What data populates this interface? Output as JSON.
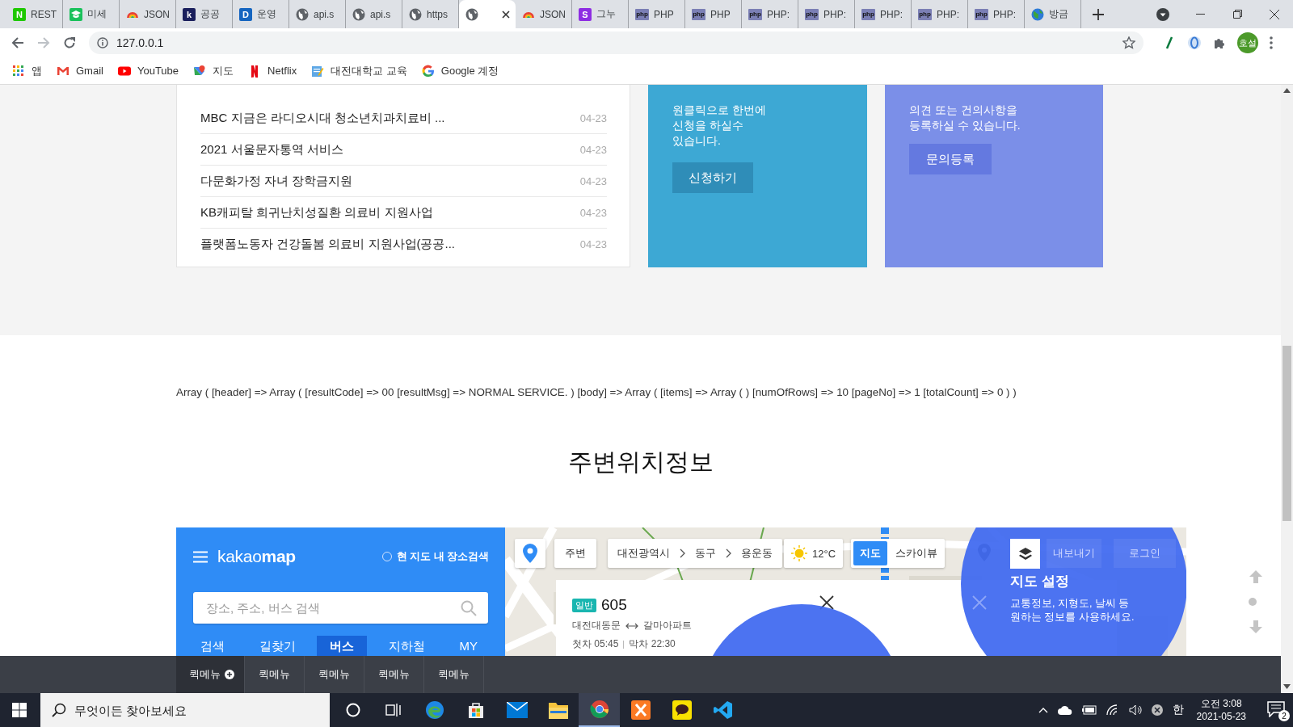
{
  "browser": {
    "tabs": [
      {
        "kind": "letter",
        "letter": "N",
        "color": "#1ec800",
        "title": "REST",
        "selected": false
      },
      {
        "kind": "cap",
        "title": "미세",
        "selected": false
      },
      {
        "kind": "rainbow",
        "title": "JSON",
        "selected": false
      },
      {
        "kind": "letter",
        "letter": "k",
        "color": "#1a1f5c",
        "title": "공공",
        "selected": false
      },
      {
        "kind": "letter",
        "letter": "D",
        "color": "#1565c0",
        "title": "운영",
        "selected": false
      },
      {
        "kind": "globe",
        "title": "api.s",
        "selected": false
      },
      {
        "kind": "globe",
        "title": "api.s",
        "selected": false
      },
      {
        "kind": "globe",
        "title": "https",
        "selected": false
      },
      {
        "kind": "globe",
        "selected": true
      },
      {
        "kind": "rainbow",
        "title": "JSON",
        "selected": false
      },
      {
        "kind": "letter",
        "letter": "S",
        "color": "#8e2de2",
        "title": "그누",
        "selected": false
      },
      {
        "kind": "php",
        "letter": "php",
        "title": "PHP",
        "selected": false
      },
      {
        "kind": "php",
        "letter": "php",
        "title": "PHP",
        "selected": false
      },
      {
        "kind": "php",
        "letter": "php",
        "title": "PHP:",
        "selected": false
      },
      {
        "kind": "php",
        "letter": "php",
        "title": "PHP:",
        "selected": false
      },
      {
        "kind": "php",
        "letter": "php",
        "title": "PHP:",
        "selected": false
      },
      {
        "kind": "php",
        "letter": "php",
        "title": "PHP:",
        "selected": false
      },
      {
        "kind": "php",
        "letter": "php",
        "title": "PHP:",
        "selected": false
      },
      {
        "kind": "earth",
        "title": "방금",
        "selected": false
      }
    ],
    "address": "127.0.0.1",
    "profile": "호설",
    "bookmarks": [
      {
        "kind": "apps",
        "label": "앱"
      },
      {
        "kind": "gmail",
        "label": "Gmail"
      },
      {
        "kind": "youtube",
        "label": "YouTube"
      },
      {
        "kind": "maps",
        "label": "지도"
      },
      {
        "kind": "netflix",
        "label": "Netflix"
      },
      {
        "kind": "note",
        "label": "대전대학교 교육"
      },
      {
        "kind": "google",
        "label": "Google 계정"
      }
    ]
  },
  "notices": [
    {
      "title": "MBC 지금은 라디오시대 청소년치과치료비 ...",
      "date": "04-23"
    },
    {
      "title": "2021 서울문자통역 서비스",
      "date": "04-23"
    },
    {
      "title": "다문화가정 자녀 장학금지원",
      "date": "04-23"
    },
    {
      "title": "KB캐피탈 희귀난치성질환 의료비 지원사업",
      "date": "04-23"
    },
    {
      "title": "플랫폼노동자 건강돌봄 의료비 지원사업(공공...",
      "date": "04-23"
    }
  ],
  "cards": [
    {
      "kind": "apply",
      "text": "원클릭으로 한번에\n신청을 하실수\n있습니다.",
      "button": "신청하기"
    },
    {
      "kind": "inquiry",
      "text": "의견 또는 건의사항을\n등록하실 수 있습니다.",
      "button": "문의등록"
    }
  ],
  "debug_output": "Array ( [header] => Array ( [resultCode] => 00 [resultMsg] => NORMAL SERVICE. ) [body] => Array ( [items] => Array ( ) [numOfRows] => 10 [pageNo] => 1 [totalCount] => 0 ) )",
  "section_title": "주변위치정보",
  "kakaomap": {
    "logo": "kakao**map**",
    "area_search": {
      "label": "현 지도 내 장소검색",
      "checked": false
    },
    "search": {
      "placeholder": "장소, 주소, 버스 검색"
    },
    "tabs": [
      {
        "label": "검색",
        "selected": false
      },
      {
        "label": "길찾기",
        "selected": false
      },
      {
        "label": "버스",
        "selected": true
      },
      {
        "label": "지하철",
        "selected": false
      },
      {
        "label": "MY",
        "selected": false
      }
    ],
    "around_button": "주변",
    "breadcrumb": [
      "대전광역시",
      "동구",
      "용운동"
    ],
    "weather": "12°C",
    "map_types": [
      {
        "label": "지도",
        "selected": true
      },
      {
        "label": "스카이뷰",
        "selected": false
      }
    ],
    "dimmed_buttons": [
      "내보내기",
      "로그인"
    ],
    "bus": {
      "type": "일반",
      "number": "605",
      "from": "대전대동문",
      "to": "갈마아파트",
      "first": "첫차 05:45",
      "last": "막차 22:30"
    },
    "tip": {
      "title": "지도 설정",
      "text": "교통정보, 지형도, 날씨 등\n원하는 정보를 사용하세요."
    }
  },
  "quick_menu": [
    {
      "label": "퀵메뉴",
      "expand": true
    },
    {
      "label": "퀵메뉴",
      "expand": false
    },
    {
      "label": "퀵메뉴",
      "expand": false
    },
    {
      "label": "퀵메뉴",
      "expand": false
    },
    {
      "label": "퀵메뉴",
      "expand": false
    }
  ],
  "taskbar": {
    "search_placeholder": "무엇이든 찾아보세요",
    "apps": [
      {
        "kind": "edge",
        "active": false
      },
      {
        "kind": "store",
        "active": false
      },
      {
        "kind": "mail",
        "active": false
      },
      {
        "kind": "explorer",
        "active": false
      },
      {
        "kind": "chrome",
        "active": true
      },
      {
        "kind": "xampp",
        "active": false
      },
      {
        "kind": "talk",
        "active": false
      },
      {
        "kind": "vscode",
        "active": false
      }
    ],
    "ime": "한",
    "time": "오전 3:08",
    "date": "2021-05-23",
    "notifications": "2"
  }
}
